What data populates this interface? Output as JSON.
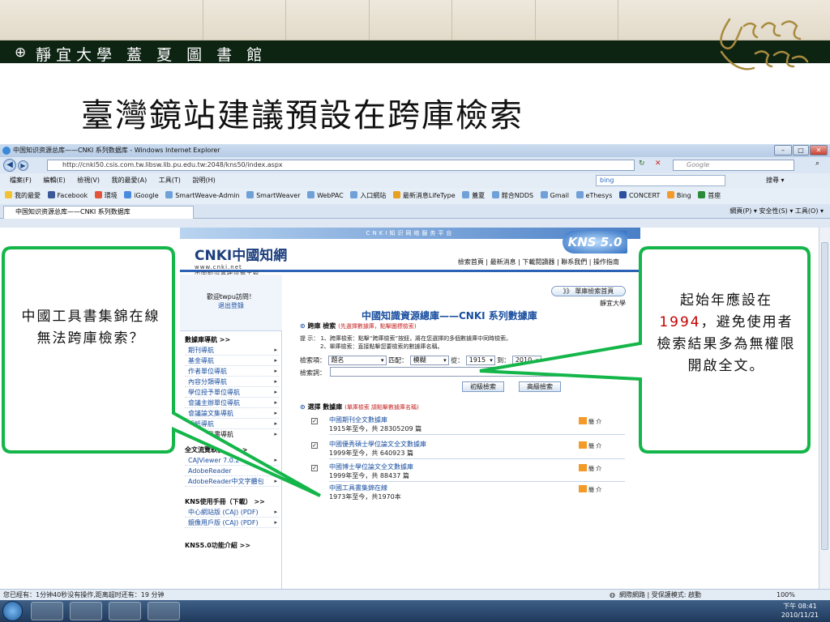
{
  "slide": {
    "library_name": "靜宜大學 蓋 夏 圖 書 館",
    "title": "臺灣鏡站建議預設在跨庫檢索"
  },
  "browser": {
    "window_title": "中国知识资源总库——CNKI 系列数据库 - Windows Internet Explorer",
    "url": "http://cnki50.csis.com.tw.libsw.lib.pu.edu.tw:2048/kns50/index.aspx",
    "search_engine": "Bing",
    "search_placeholder": "Google",
    "menu": [
      "檔案(F)",
      "編輯(E)",
      "檢視(V)",
      "我的最愛(A)",
      "工具(T)",
      "說明(H)"
    ],
    "bing_label": "bing",
    "bing_extra": "搜尋 ▾",
    "favorites_label": "我的最愛",
    "favorites": [
      "Facebook",
      "環境",
      "iGoogle",
      "SmartWeave-Admin",
      "SmartWeaver",
      "WebPAC",
      "入口網站",
      "最新消息LifeType",
      "蓋夏",
      "館合NDDS",
      "Gmail",
      "eThesys",
      "CONCERT",
      "Bing",
      "首座"
    ],
    "tab_label": "中国知识资源总库——CNKI 系列数据库",
    "tab_tools": "網頁(P) ▾  安全性(S) ▾  工具(O) ▾",
    "status_left": "您已經有：1分钟40秒没有操作,距离超时还有：19 分钟",
    "status_zone": "網際網路 | 受保護模式: 啟動",
    "zoom": "100%",
    "clock_time": "下午 08:41",
    "clock_date": "2010/11/21"
  },
  "cnki": {
    "top_banner": "CNKI知识网络服务平台",
    "logo": "CNKI中國知網",
    "logo_url": "www.cnki.net",
    "logo_subtitle": "中国知识基础设施工程",
    "version_badge": "KNS 5.0",
    "nav_links": "檢索首頁 | 最新消息 | 下載閱讀器 | 聯系我們 | 操作指南",
    "single_db_button": "》》 單庫檢索首頁",
    "institution": "靜宜大學",
    "welcome": "歡迎twpu訪問！",
    "logout": "退出登錄",
    "nav_heading": "數據庫導航 >>",
    "nav_items": [
      "期刊導航",
      "基金導航",
      "作者單位導航",
      "內容分類導航",
      "學位授予單位導航",
      "會議主辦單位導航",
      "會議論文集導航",
      "報紙導航",
      "中國工具書導航"
    ],
    "download_heading": "全文流覽軟體下載>>",
    "download_items": [
      "CAJViewer 7.0.2",
      "AdobeReader",
      "AdobeReader中文字體包"
    ],
    "manual_heading": "KNS使用手冊（下載） >>",
    "manual_items": [
      "中心網站版 (CAJ) (PDF)",
      "鏡像用戶版 (CAJ) (PDF)"
    ],
    "intro_heading": "KNS5.0功能介紹 >>",
    "page_title": "中國知識資源總庫——CNKI 系列數據庫",
    "cross_db_label": "跨庫 檢索",
    "cross_db_sub": "(先選擇數據庫，點擊圖標檢索)",
    "hint_1": "提  示： 1、跨庫檢索：點擊“跨庫檢索”按鈕，將在您選擇的多個數據庫中同時檢索。",
    "hint_2": "2、單庫檢索：直接點擊您要檢索的數據庫名稱。",
    "field_label": "檢索項：",
    "field_value": "題名",
    "match_label": "匹配：",
    "match_value": "模糊",
    "from_label": "從：",
    "from_value": "1915",
    "to_label": "到：",
    "to_value": "2010",
    "keyword_label": "檢索詞：",
    "primary_button": "初級檢索",
    "advanced_button": "高級檢索",
    "select_db_label": "選擇 數據庫",
    "select_db_sub": "(單庫檢索 請點擊數據庫名稱)",
    "databases": [
      {
        "name": "中國期刊全文數據庫",
        "count": "1915年至今，共 28305209 篇",
        "checked": "✓"
      },
      {
        "name": "中國優秀碩士學位論文全文數據庫",
        "count": "1999年至今，共 640923 篇",
        "checked": "✓"
      },
      {
        "name": "中國博士學位論文全文數據庫",
        "count": "1999年至今，共 88437 篇",
        "checked": "✓"
      },
      {
        "name": "中國工具書集錦在線",
        "count": "1973年至今，共1970本",
        "checked": ""
      }
    ],
    "intro_label": "簡 介"
  },
  "callouts": {
    "left": "中國工具書集錦在線 無法跨庫檢索？",
    "right_pre": "起始年應設在",
    "right_year": "1994",
    "right_post": "，避免使用者檢索結果多為無權限開啟全文。"
  },
  "colors": {
    "callout_fill": "#14b64a",
    "callout_inner": "#ffffff",
    "header_bar": "#0d2413",
    "accent_blue": "#1a4fa0"
  }
}
